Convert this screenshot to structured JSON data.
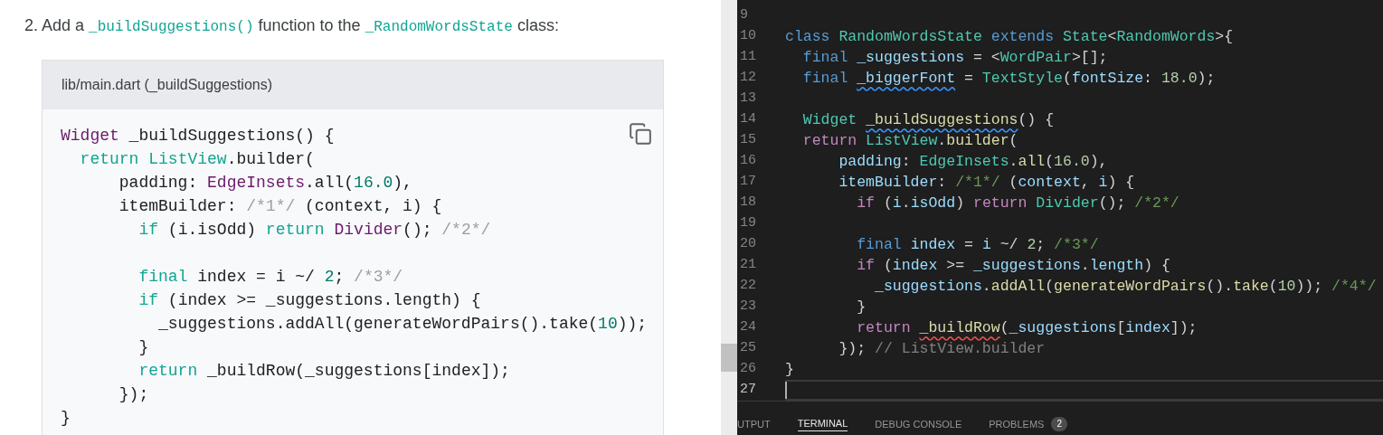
{
  "tutorial": {
    "step": [
      {
        "kind": "text",
        "text": "2. Add a"
      },
      {
        "kind": "code",
        "text": "_buildSuggestions()"
      },
      {
        "kind": "text",
        "text": "function to the"
      },
      {
        "kind": "code",
        "text": "_RandomWordsState"
      },
      {
        "kind": "text",
        "text": "class:"
      }
    ],
    "snippet": {
      "title": "lib/main.dart (_buildSuggestions)",
      "lines": [
        {
          "tokens": [
            {
              "kind": "type",
              "text": "Widget"
            },
            {
              "kind": "plain",
              "text": " _buildSuggestions() {"
            }
          ]
        },
        {
          "tokens": [
            {
              "kind": "keyword",
              "text": "  return"
            },
            {
              "kind": "keyword",
              "text": " ListView"
            },
            {
              "kind": "plain",
              "text": ".builder("
            }
          ]
        },
        {
          "tokens": [
            {
              "kind": "plain",
              "text": "      padding: "
            },
            {
              "kind": "type",
              "text": "EdgeInsets"
            },
            {
              "kind": "plain",
              "text": ".all("
            },
            {
              "kind": "number",
              "text": "16.0"
            },
            {
              "kind": "plain",
              "text": "),"
            }
          ]
        },
        {
          "tokens": [
            {
              "kind": "plain",
              "text": "      itemBuilder: "
            },
            {
              "kind": "comment",
              "text": "/*1*/"
            },
            {
              "kind": "plain",
              "text": " (context, i) {"
            }
          ]
        },
        {
          "tokens": [
            {
              "kind": "keyword",
              "text": "        if"
            },
            {
              "kind": "plain",
              "text": " (i.isOdd) "
            },
            {
              "kind": "keyword",
              "text": "return"
            },
            {
              "kind": "type",
              "text": " Divider"
            },
            {
              "kind": "plain",
              "text": "(); "
            },
            {
              "kind": "comment",
              "text": "/*2*/"
            }
          ]
        },
        {
          "blank_line_before": true,
          "tokens": [
            {
              "kind": "keyword",
              "text": "        final"
            },
            {
              "kind": "plain",
              "text": " index = i ~/ "
            },
            {
              "kind": "number",
              "text": "2"
            },
            {
              "kind": "plain",
              "text": "; "
            },
            {
              "kind": "comment",
              "text": "/*3*/"
            }
          ]
        },
        {
          "tokens": [
            {
              "kind": "keyword",
              "text": "        if"
            },
            {
              "kind": "plain",
              "text": " (index >= _suggestions.length) {"
            }
          ]
        },
        {
          "tokens": [
            {
              "kind": "plain",
              "text": "          _suggestions.addAll(generateWordPairs().take("
            },
            {
              "kind": "number",
              "text": "10"
            },
            {
              "kind": "plain",
              "text": "));"
            }
          ]
        },
        {
          "tokens": [
            {
              "kind": "plain",
              "text": "        }"
            }
          ]
        },
        {
          "tokens": [
            {
              "kind": "keyword",
              "text": "        return"
            },
            {
              "kind": "plain",
              "text": " _buildRow(_suggestions[index]);"
            }
          ]
        },
        {
          "tokens": [
            {
              "kind": "plain",
              "text": "      });"
            }
          ]
        },
        {
          "tokens": [
            {
              "kind": "plain",
              "text": "}"
            }
          ]
        }
      ]
    }
  },
  "editor": {
    "lines": [
      {
        "number": "9",
        "current": false
      },
      {
        "number": "10",
        "current": false,
        "tokens": [
          {
            "kind": "storage",
            "text": "class"
          },
          {
            "kind": "type",
            "text": " RandomWordsState"
          },
          {
            "kind": "storage",
            "text": " extends"
          },
          {
            "kind": "type",
            "text": " State"
          },
          {
            "kind": "plain",
            "text": "<"
          },
          {
            "kind": "type",
            "text": "RandomWords"
          },
          {
            "kind": "plain",
            "text": ">{"
          }
        ]
      },
      {
        "number": "11",
        "current": false,
        "tokens": [
          {
            "kind": "storage",
            "text": "  final"
          },
          {
            "kind": "variable",
            "text": " _suggestions"
          },
          {
            "kind": "plain",
            "text": " = <"
          },
          {
            "kind": "type",
            "text": "WordPair"
          },
          {
            "kind": "plain",
            "text": ">[];"
          }
        ]
      },
      {
        "number": "12",
        "current": false,
        "tokens": [
          {
            "kind": "storage",
            "text": "  final "
          },
          {
            "kind": "variable",
            "text": "_biggerFont",
            "warning": true
          },
          {
            "kind": "plain",
            "text": " = "
          },
          {
            "kind": "type",
            "text": "TextStyle"
          },
          {
            "kind": "plain",
            "text": "("
          },
          {
            "kind": "variable",
            "text": "fontSize"
          },
          {
            "kind": "plain",
            "text": ": "
          },
          {
            "kind": "number",
            "text": "18.0"
          },
          {
            "kind": "plain",
            "text": ");"
          }
        ]
      },
      {
        "number": "13",
        "current": false
      },
      {
        "number": "14",
        "current": false,
        "tokens": [
          {
            "kind": "type",
            "text": "  Widget "
          },
          {
            "kind": "function",
            "text": "_buildSuggestions",
            "warning": true
          },
          {
            "kind": "plain",
            "text": "() {"
          }
        ]
      },
      {
        "number": "15",
        "current": false,
        "tokens": [
          {
            "kind": "control",
            "text": "  return"
          },
          {
            "kind": "type",
            "text": " ListView"
          },
          {
            "kind": "plain",
            "text": "."
          },
          {
            "kind": "function",
            "text": "builder"
          },
          {
            "kind": "plain",
            "text": "("
          }
        ]
      },
      {
        "number": "16",
        "current": false,
        "tokens": [
          {
            "kind": "variable",
            "text": "      padding"
          },
          {
            "kind": "plain",
            "text": ": "
          },
          {
            "kind": "type",
            "text": "EdgeInsets"
          },
          {
            "kind": "plain",
            "text": "."
          },
          {
            "kind": "function",
            "text": "all"
          },
          {
            "kind": "plain",
            "text": "("
          },
          {
            "kind": "number",
            "text": "16.0"
          },
          {
            "kind": "plain",
            "text": "),"
          }
        ]
      },
      {
        "number": "17",
        "current": false,
        "tokens": [
          {
            "kind": "variable",
            "text": "      itemBuilder"
          },
          {
            "kind": "plain",
            "text": ": "
          },
          {
            "kind": "comment",
            "text": "/*1*/"
          },
          {
            "kind": "plain",
            "text": " ("
          },
          {
            "kind": "variable",
            "text": "context"
          },
          {
            "kind": "plain",
            "text": ", "
          },
          {
            "kind": "variable",
            "text": "i"
          },
          {
            "kind": "plain",
            "text": ") {"
          }
        ]
      },
      {
        "number": "18",
        "current": false,
        "tokens": [
          {
            "kind": "control",
            "text": "        if"
          },
          {
            "kind": "plain",
            "text": " ("
          },
          {
            "kind": "variable",
            "text": "i"
          },
          {
            "kind": "plain",
            "text": "."
          },
          {
            "kind": "variable",
            "text": "isOdd"
          },
          {
            "kind": "plain",
            "text": ") "
          },
          {
            "kind": "control",
            "text": "return"
          },
          {
            "kind": "type",
            "text": " Divider"
          },
          {
            "kind": "plain",
            "text": "(); "
          },
          {
            "kind": "comment",
            "text": "/*2*/"
          }
        ]
      },
      {
        "number": "19",
        "current": false
      },
      {
        "number": "20",
        "current": false,
        "tokens": [
          {
            "kind": "storage",
            "text": "        final"
          },
          {
            "kind": "variable",
            "text": " index"
          },
          {
            "kind": "plain",
            "text": " = "
          },
          {
            "kind": "variable",
            "text": "i"
          },
          {
            "kind": "plain",
            "text": " ~/ "
          },
          {
            "kind": "number",
            "text": "2"
          },
          {
            "kind": "plain",
            "text": "; "
          },
          {
            "kind": "comment",
            "text": "/*3*/"
          }
        ]
      },
      {
        "number": "21",
        "current": false,
        "tokens": [
          {
            "kind": "control",
            "text": "        if"
          },
          {
            "kind": "plain",
            "text": " ("
          },
          {
            "kind": "variable",
            "text": "index"
          },
          {
            "kind": "plain",
            "text": " >= "
          },
          {
            "kind": "variable",
            "text": "_suggestions"
          },
          {
            "kind": "plain",
            "text": "."
          },
          {
            "kind": "variable",
            "text": "length"
          },
          {
            "kind": "plain",
            "text": ") {"
          }
        ]
      },
      {
        "number": "22",
        "current": false,
        "tokens": [
          {
            "kind": "variable",
            "text": "          _suggestions"
          },
          {
            "kind": "plain",
            "text": "."
          },
          {
            "kind": "function",
            "text": "addAll"
          },
          {
            "kind": "plain",
            "text": "("
          },
          {
            "kind": "function",
            "text": "generateWordPairs"
          },
          {
            "kind": "plain",
            "text": "()."
          },
          {
            "kind": "function",
            "text": "take"
          },
          {
            "kind": "plain",
            "text": "("
          },
          {
            "kind": "number",
            "text": "10"
          },
          {
            "kind": "plain",
            "text": ")); "
          },
          {
            "kind": "comment",
            "text": "/*4*/"
          }
        ]
      },
      {
        "number": "23",
        "current": false,
        "tokens": [
          {
            "kind": "plain",
            "text": "        }"
          }
        ]
      },
      {
        "number": "24",
        "current": false,
        "tokens": [
          {
            "kind": "control",
            "text": "        return "
          },
          {
            "kind": "function",
            "text": "_buildRow",
            "error": true
          },
          {
            "kind": "plain",
            "text": "("
          },
          {
            "kind": "variable",
            "text": "_suggestions"
          },
          {
            "kind": "plain",
            "text": "["
          },
          {
            "kind": "variable",
            "text": "index"
          },
          {
            "kind": "plain",
            "text": "]);"
          }
        ]
      },
      {
        "number": "25",
        "current": false,
        "tokens": [
          {
            "kind": "plain",
            "text": "      }); "
          },
          {
            "kind": "label",
            "text": "// ListView.builder"
          }
        ]
      },
      {
        "number": "26",
        "current": false,
        "tokens": [
          {
            "kind": "plain",
            "text": "}"
          }
        ]
      },
      {
        "number": "27",
        "current": true
      }
    ]
  },
  "panel_tabs": [
    {
      "label": "UTPUT",
      "selected": false
    },
    {
      "label": "TERMINAL",
      "selected": true
    },
    {
      "label": "DEBUG CONSOLE",
      "selected": false
    },
    {
      "label": "PROBLEMS",
      "selected": false,
      "badge": "2"
    }
  ]
}
